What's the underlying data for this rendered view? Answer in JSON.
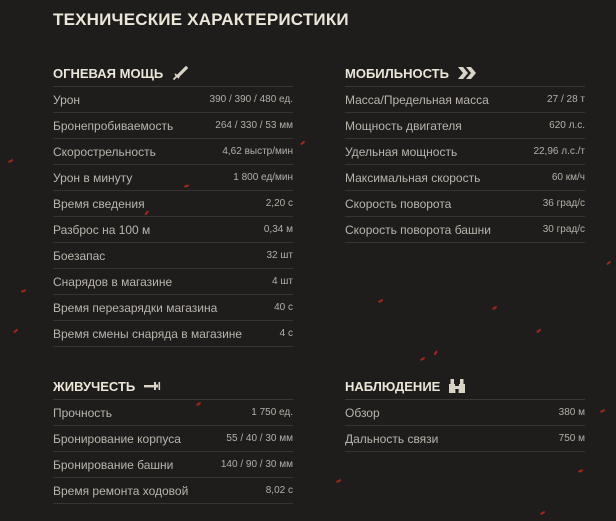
{
  "title": "ТЕХНИЧЕСКИЕ ХАРАКТЕРИСТИКИ",
  "colors": {
    "background": "#1f1d1c",
    "heading": "#ebe6d8",
    "text": "#b9b5ad",
    "divider": "#3a3735",
    "spark": "#c0281a"
  },
  "firepower": {
    "title": "ОГНЕВАЯ МОЩЬ",
    "icon": "sword-icon",
    "rows": [
      {
        "label": "Урон",
        "value": "390 / 390 / 480 ед."
      },
      {
        "label": "Бронепробиваемость",
        "value": "264 / 330 / 53 мм"
      },
      {
        "label": "Скорострельность",
        "value": "4,62 выстр/мин"
      },
      {
        "label": "Урон в минуту",
        "value": "1 800 ед/мин"
      },
      {
        "label": "Время сведения",
        "value": "2,20 с"
      },
      {
        "label": "Разброс на 100 м",
        "value": "0,34 м"
      },
      {
        "label": "Боезапас",
        "value": "32 шт"
      },
      {
        "label": "Снарядов в магазине",
        "value": "4 шт"
      },
      {
        "label": "Время перезарядки магазина",
        "value": "40 с"
      },
      {
        "label": "Время смены снаряда в магазине",
        "value": "4 с"
      }
    ]
  },
  "mobility": {
    "title": "МОБИЛЬНОСТЬ",
    "icon": "double-chevron-right-icon",
    "rows": [
      {
        "label": "Масса/Предельная масса",
        "value": "27 / 28 т"
      },
      {
        "label": "Мощность двигателя",
        "value": "620 л.с."
      },
      {
        "label": "Удельная мощность",
        "value": "22,96 л.с./т"
      },
      {
        "label": "Максимальная скорость",
        "value": "60 км/ч"
      },
      {
        "label": "Скорость поворота",
        "value": "36 град/с"
      },
      {
        "label": "Скорость поворота башни",
        "value": "30 град/с"
      }
    ]
  },
  "survivability": {
    "title": "ЖИВУЧЕСТЬ",
    "icon": "wrench-icon",
    "rows": [
      {
        "label": "Прочность",
        "value": "1 750 ед."
      },
      {
        "label": "Бронирование корпуса",
        "value": "55 / 40 / 30 мм"
      },
      {
        "label": "Бронирование башни",
        "value": "140 / 90 / 30 мм"
      },
      {
        "label": "Время ремонта ходовой",
        "value": "8,02 с"
      }
    ]
  },
  "observation": {
    "title": "НАБЛЮДЕНИЕ",
    "icon": "binoculars-icon",
    "rows": [
      {
        "label": "Обзор",
        "value": "380 м"
      },
      {
        "label": "Дальность связи",
        "value": "750 м"
      }
    ]
  }
}
